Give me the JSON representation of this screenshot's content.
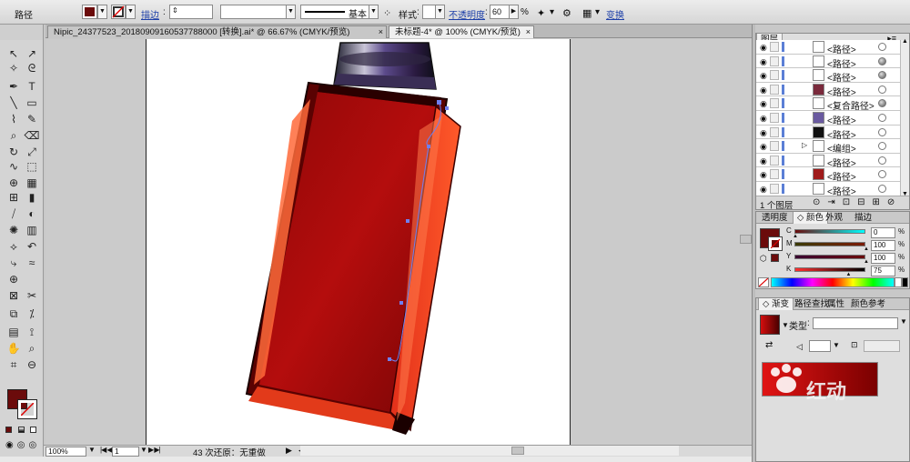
{
  "control_bar": {
    "selection_label": "路径",
    "fill_color": "#6b0b0b",
    "stroke_label": "描边",
    "stroke_profile_label": "基本",
    "style_label": "样式",
    "opacity_label": "不透明度",
    "opacity_value": "60",
    "opacity_unit": "%",
    "transform_label": "变换"
  },
  "tabs": [
    {
      "label": "Nipic_24377523_20180909160537788000 [转换].ai* @ 66.67% (CMYK/预览)",
      "active": false
    },
    {
      "label": "未标题-4* @ 100% (CMYK/预览)",
      "active": true
    }
  ],
  "status_bar": {
    "zoom": "100%",
    "artboard": "1",
    "undo_text": "43 次还原：无重做"
  },
  "layers_panel": {
    "tab": "图层",
    "items": [
      {
        "name": "<路径>",
        "thumb": "#ffffff",
        "target": "hollow"
      },
      {
        "name": "<路径>",
        "thumb": "#ffffff",
        "target": "filled"
      },
      {
        "name": "<路径>",
        "thumb": "#ffffff",
        "target": "filled"
      },
      {
        "name": "<路径>",
        "thumb": "#7a2a3c",
        "target": "hollow"
      },
      {
        "name": "<复合路径>",
        "thumb": "#ffffff",
        "target": "filled"
      },
      {
        "name": "<路径>",
        "thumb": "#6a5aa0",
        "target": "hollow"
      },
      {
        "name": "<路径>",
        "thumb": "#111111",
        "target": "hollow"
      },
      {
        "name": "<编组>",
        "thumb": "#ffffff",
        "target": "hollow"
      },
      {
        "name": "<路径>",
        "thumb": "#ffffff",
        "target": "hollow"
      },
      {
        "name": "<路径>",
        "thumb": "#a01b1b",
        "target": "hollow"
      },
      {
        "name": "<路径>",
        "thumb": "#ffffff",
        "target": "hollow"
      }
    ],
    "footer": "1 个图层"
  },
  "color_panel": {
    "tabs": [
      "透明度",
      "颜色",
      "外观",
      "描边"
    ],
    "active_tab": "颜色",
    "fill_color": "#6b0b0b",
    "channels": [
      {
        "label": "C",
        "value": "0",
        "fraction": 0.0
      },
      {
        "label": "M",
        "value": "100",
        "fraction": 1.0
      },
      {
        "label": "Y",
        "value": "100",
        "fraction": 1.0
      },
      {
        "label": "K",
        "value": "75",
        "fraction": 0.75
      }
    ],
    "percent_unit": "%"
  },
  "gradient_panel": {
    "tabs": [
      "渐变",
      "路径查找",
      "属性",
      "颜色参考"
    ],
    "active_tab": "渐变",
    "type_label": "类型",
    "watermark": "红动"
  }
}
